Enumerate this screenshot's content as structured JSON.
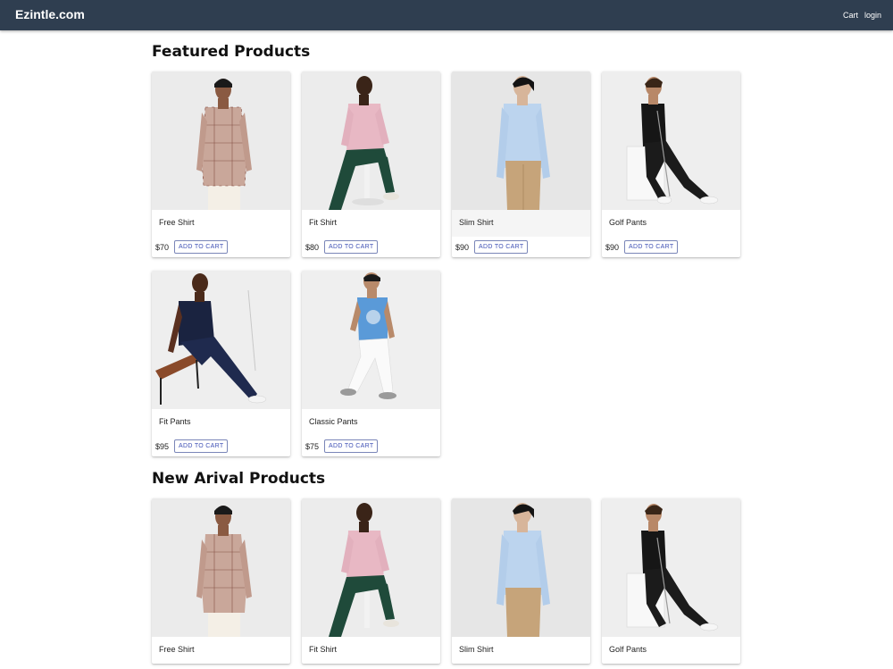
{
  "navbar": {
    "brand": "Ezintle.com",
    "links": {
      "cart": "Cart",
      "login": "login"
    }
  },
  "sections": {
    "featured": {
      "title": "Featured Products",
      "products": [
        {
          "name": "Free Shirt",
          "price": "$70",
          "button": "ADD TO CART",
          "image": "model-plaid-shirt"
        },
        {
          "name": "Fit Shirt",
          "price": "$80",
          "button": "ADD TO CART",
          "image": "model-pink-shirt-seated"
        },
        {
          "name": "Slim Shirt",
          "price": "$90",
          "button": "ADD TO CART",
          "image": "model-light-blue-shirt"
        },
        {
          "name": "Golf Pants",
          "price": "$90",
          "button": "ADD TO CART",
          "image": "model-black-golf"
        },
        {
          "name": "Fit Pants",
          "price": "$95",
          "button": "ADD TO CART",
          "image": "model-navy-bench"
        },
        {
          "name": "Classic Pants",
          "price": "$75",
          "button": "ADD TO CART",
          "image": "model-blue-tee-walking"
        }
      ]
    },
    "new_arrival": {
      "title": "New Arival Products",
      "products": [
        {
          "name": "Free Shirt",
          "image": "model-plaid-shirt"
        },
        {
          "name": "Fit Shirt",
          "image": "model-pink-shirt-seated"
        },
        {
          "name": "Slim Shirt",
          "image": "model-light-blue-shirt"
        },
        {
          "name": "Golf Pants",
          "image": "model-black-golf"
        }
      ]
    }
  },
  "colors": {
    "navbar": "#2f3e50",
    "accent": "#3f51b5"
  }
}
